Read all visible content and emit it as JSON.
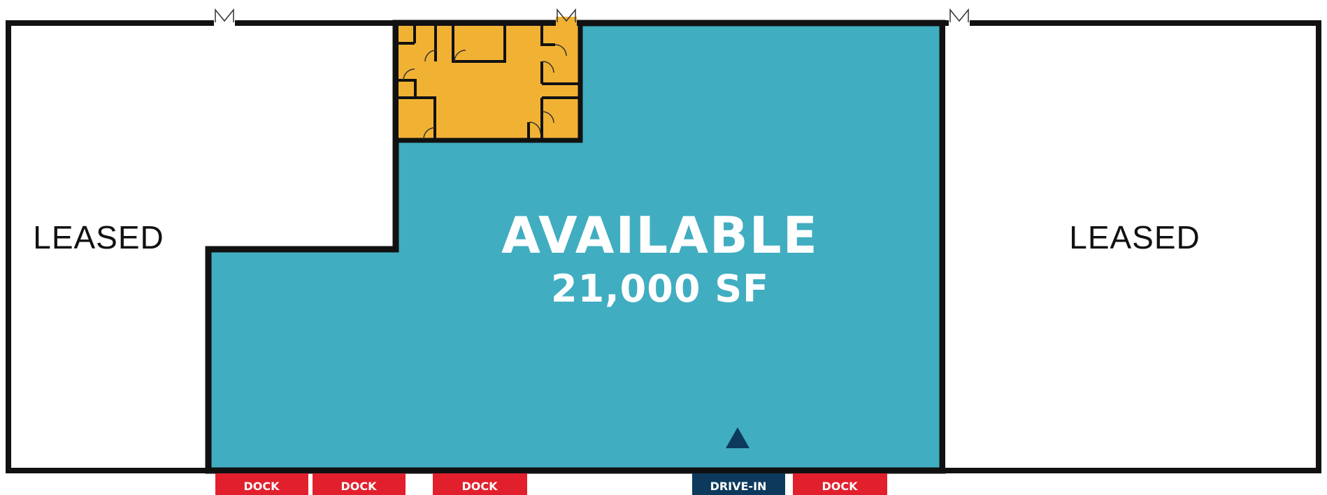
{
  "units": {
    "left": {
      "label": "LEASED"
    },
    "right": {
      "label": "LEASED"
    },
    "available": {
      "label": "AVAILABLE",
      "area": "21,000 SF"
    }
  },
  "doors": [
    {
      "label": "DOCK",
      "type": "dock"
    },
    {
      "label": "DOCK",
      "type": "dock"
    },
    {
      "label": "DOCK",
      "type": "dock"
    },
    {
      "label": "DRIVE-IN",
      "type": "drive-in"
    },
    {
      "label": "DOCK",
      "type": "dock"
    }
  ],
  "colors": {
    "available": "#41adc0",
    "office": "#f1b234",
    "dock": "#e2202d",
    "drive_in": "#0d3a5c",
    "walls": "#111111",
    "leased": "#ffffff"
  }
}
